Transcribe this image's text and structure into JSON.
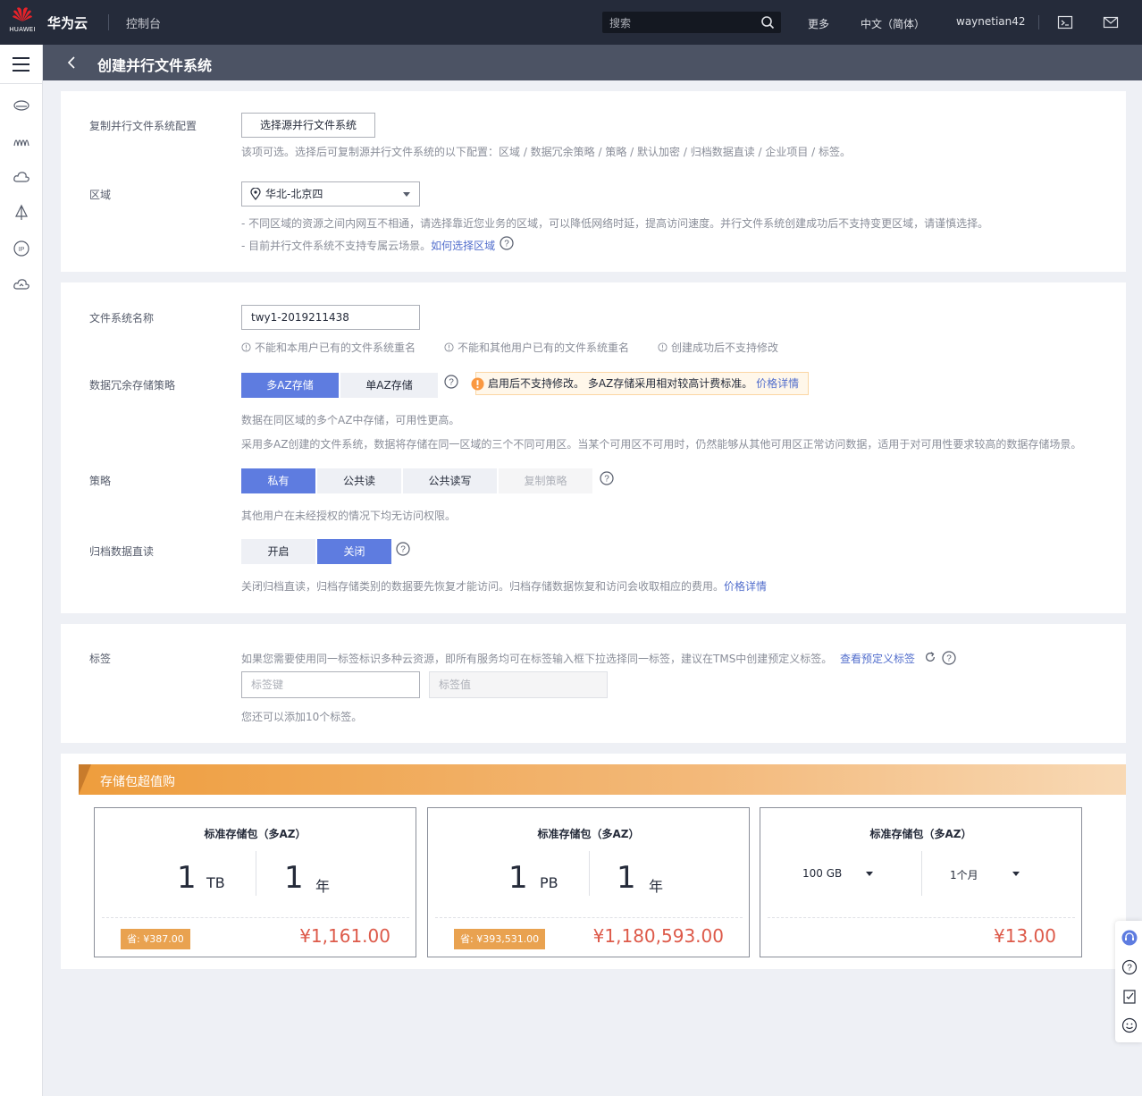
{
  "header": {
    "logo_text": "HUAWEI",
    "brand": "华为云",
    "console": "控制台",
    "search_placeholder": "搜索",
    "more": "更多",
    "language": "中文（简体）",
    "username": "waynetian42"
  },
  "page": {
    "title": "创建并行文件系统"
  },
  "section1": {
    "copy_label": "复制并行文件系统配置",
    "copy_button": "选择源并行文件系统",
    "copy_hint": "该项可选。选择后可复制源并行文件系统的以下配置：区域 / 数据冗余策略 / 策略 / 默认加密 / 归档数据直读 / 企业项目 / 标签。",
    "region_label": "区域",
    "region_value": "华北-北京四",
    "region_hint1": "- 不同区域的资源之间内网互不相通，请选择靠近您业务的区域，可以降低网络时延，提高访问速度。并行文件系统创建成功后不支持变更区域，请谨慎选择。",
    "region_hint2": "- 目前并行文件系统不支持专属云场景。",
    "region_link": "如何选择区域"
  },
  "section2": {
    "name_label": "文件系统名称",
    "name_value": "twy1-2019211438",
    "name_rule1": "不能和本用户已有的文件系统重名",
    "name_rule2": "不能和其他用户已有的文件系统重名",
    "name_rule3": "创建成功后不支持修改",
    "redundancy_label": "数据冗余存储策略",
    "redundancy_options": [
      "多AZ存储",
      "单AZ存储"
    ],
    "redundancy_selected": "多AZ存储",
    "warning_text": "启用后不支持修改。 多AZ存储采用相对较高计费标准。",
    "warning_link": "价格详情",
    "redundancy_hint1": "数据在同区域的多个AZ中存储，可用性更高。",
    "redundancy_hint2": "采用多AZ创建的文件系统，数据将存储在同一区域的三个不同可用区。当某个可用区不可用时，仍然能够从其他可用区正常访问数据，适用于对可用性要求较高的数据存储场景。",
    "policy_label": "策略",
    "policy_options": [
      "私有",
      "公共读",
      "公共读写",
      "复制策略"
    ],
    "policy_selected": "私有",
    "policy_hint": "其他用户在未经授权的情况下均无访问权限。",
    "archive_label": "归档数据直读",
    "archive_options": [
      "开启",
      "关闭"
    ],
    "archive_selected": "关闭",
    "archive_hint": "关闭归档直读，归档存储类别的数据要先恢复才能访问。归档存储数据恢复和访问会收取相应的费用。",
    "archive_link": "价格详情"
  },
  "section3": {
    "tag_label": "标签",
    "tag_hint": "如果您需要使用同一标签标识多种云资源，即所有服务均可在标签输入框下拉选择同一标签，建议在TMS中创建预定义标签。",
    "tag_link": "查看预定义标签",
    "tag_key_placeholder": "标签键",
    "tag_value_placeholder": "标签值",
    "tag_remaining": "您还可以添加10个标签。"
  },
  "promo": {
    "title": "存储包超值购",
    "packages": [
      {
        "title": "标准存储包（多AZ）",
        "size": "1",
        "size_unit": "TB",
        "period": "1",
        "period_unit": "年",
        "save": "省: ¥387.00",
        "price": "¥1,161.00"
      },
      {
        "title": "标准存储包（多AZ）",
        "size": "1",
        "size_unit": "PB",
        "period": "1",
        "period_unit": "年",
        "save": "省: ¥393,531.00",
        "price": "¥1,180,593.00"
      },
      {
        "title": "标准存储包（多AZ）",
        "size_select": "100 GB",
        "period_select": "1个月",
        "price": "¥13.00"
      }
    ]
  },
  "colors": {
    "header_bg": "#252b3a",
    "title_bar_bg": "#4c5364",
    "primary": "#5e7ce0",
    "link": "#526ecc",
    "price": "#dd5a4a",
    "promo": "#ee9d3d"
  },
  "icons": {
    "sidebar": [
      "menu-icon",
      "object-storage-icon",
      "bucket-icon",
      "cloud-icon",
      "sail-icon",
      "ip-icon",
      "cloud-upload-icon"
    ],
    "float_bar": [
      "customer-service-icon",
      "help-icon",
      "feedback-icon",
      "smile-icon"
    ]
  }
}
